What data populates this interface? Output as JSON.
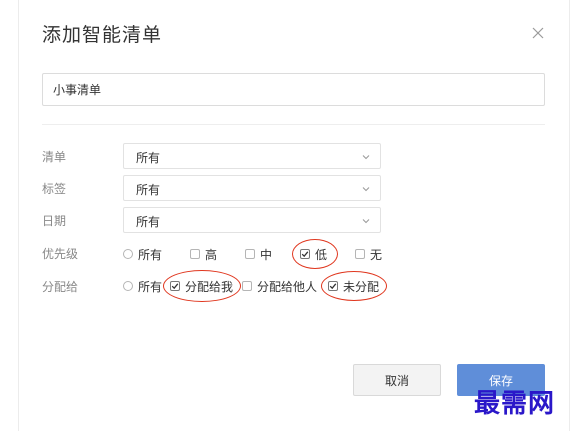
{
  "dialog": {
    "title": "添加智能清单",
    "close_icon": "close-icon"
  },
  "name_field": {
    "value": "小事清单"
  },
  "filters": {
    "list": {
      "label": "清单",
      "value": "所有"
    },
    "tag": {
      "label": "标签",
      "value": "所有"
    },
    "date": {
      "label": "日期",
      "value": "所有"
    }
  },
  "priority": {
    "label": "优先级",
    "options": [
      {
        "label": "所有",
        "type": "radio",
        "checked": false
      },
      {
        "label": "高",
        "type": "checkbox",
        "checked": false
      },
      {
        "label": "中",
        "type": "checkbox",
        "checked": false
      },
      {
        "label": "低",
        "type": "checkbox",
        "checked": true,
        "highlighted": true
      },
      {
        "label": "无",
        "type": "checkbox",
        "checked": false
      }
    ]
  },
  "assignee": {
    "label": "分配给",
    "options": [
      {
        "label": "所有",
        "type": "radio",
        "checked": false
      },
      {
        "label": "分配给我",
        "type": "checkbox",
        "checked": true,
        "highlighted": true
      },
      {
        "label": "分配给他人",
        "type": "checkbox",
        "checked": false
      },
      {
        "label": "未分配",
        "type": "checkbox",
        "checked": true,
        "highlighted": true
      }
    ]
  },
  "buttons": {
    "cancel": "取消",
    "save": "保存"
  },
  "watermark": {
    "text": "最需网",
    "color": "#2a17c9"
  },
  "colors": {
    "accent": "#5f8ed9",
    "annotation": "#e0371f"
  }
}
